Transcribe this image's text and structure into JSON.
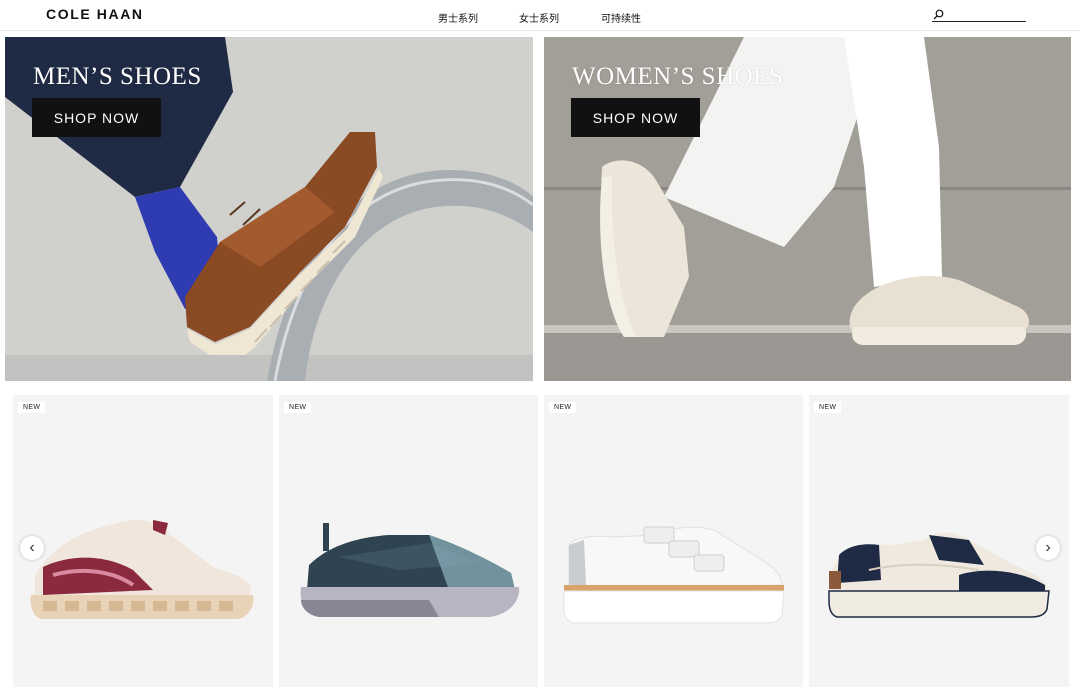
{
  "header": {
    "logo": "COLE HAAN",
    "nav": [
      {
        "label": "男士系列"
      },
      {
        "label": "女士系列"
      },
      {
        "label": "可持续性"
      }
    ],
    "search": {
      "icon": "search-icon",
      "value": ""
    }
  },
  "hero": {
    "men": {
      "title": "MEN’S SHOES",
      "cta": "SHOP NOW"
    },
    "women": {
      "title": "WOMEN’S SHOES",
      "cta": "SHOP NOW"
    }
  },
  "products": [
    {
      "badge": "NEW",
      "colors": {
        "upper": "#f1e6dc",
        "accent": "#8b2a3f",
        "sole": "#e9d3b8"
      }
    },
    {
      "badge": "NEW",
      "colors": {
        "upper": "#2f4450",
        "accent": "#8fb3bf",
        "sole": "#b9b4c2"
      }
    },
    {
      "badge": "NEW",
      "colors": {
        "upper": "#f8f8f8",
        "accent": "#d1d1d1",
        "sole": "#ffffff"
      }
    },
    {
      "badge": "NEW",
      "colors": {
        "upper": "#efe9df",
        "accent": "#1f2a44",
        "sole": "#f1ece2"
      }
    }
  ],
  "carousel": {
    "prev_icon": "chevron-left-icon",
    "next_icon": "chevron-right-icon",
    "prev": "‹",
    "next": "›"
  }
}
